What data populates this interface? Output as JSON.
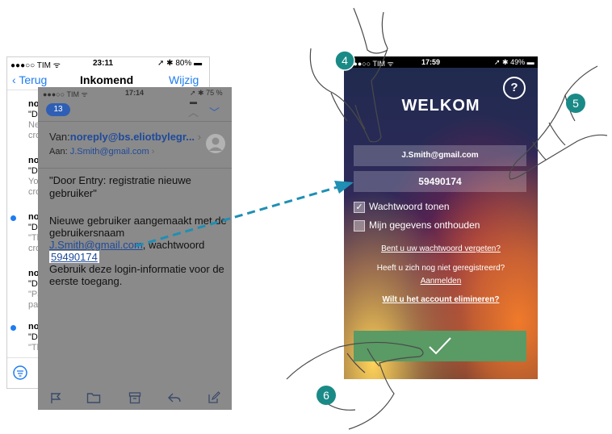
{
  "inbox": {
    "status": {
      "carrier": "●●●○○ TIM ᯤ",
      "time": "23:11",
      "battery": "➚ ✱ 80% ▬"
    },
    "nav": {
      "back": "Terug",
      "title": "Inkomend",
      "edit": "Wijzig"
    },
    "rows": [
      {
        "sender": "nor",
        "subject": "\"Do",
        "preview1": "New",
        "preview2": "cro",
        "unread": false
      },
      {
        "sender": "nor",
        "subject": "\"Do",
        "preview1": "You",
        "preview2": "cro",
        "unread": false
      },
      {
        "sender": "nor",
        "subject": "\"Do",
        "preview1": "\"Th",
        "preview2": "cro",
        "unread": true
      },
      {
        "sender": "nor",
        "subject": "\"Do",
        "preview1": "\"Pa",
        "preview2": "pas",
        "unread": false
      },
      {
        "sender": "nor",
        "subject": "\"Do",
        "preview1": "\"Th",
        "preview2": "",
        "unread": true
      }
    ]
  },
  "email": {
    "status": {
      "carrier": "●●●○○ TIM ᯤ",
      "time": "17:14",
      "battery": "➚ ✱ 75 % ▬"
    },
    "badge": "13",
    "from_label": "Van:",
    "from_address": "noreply@bs.eliotbylegr...",
    "to_label": "Aan:",
    "to_address": "J.Smith@gmail.com",
    "subject": "\"Door Entry: registratie nieuwe gebruiker\"",
    "body_line1": "Nieuwe gebruiker aangemaakt met de gebruikersnaam",
    "body_user": "J.Smith@gmail.com",
    "body_pw_label": ", wachtwoord",
    "body_password": "59490174",
    "body_line3": "Gebruik deze login-informatie voor de eerste toegang."
  },
  "login": {
    "status": {
      "carrier": "●●●○○ TIM ᯤ",
      "time": "17:59",
      "battery": "➚ ✱ 49% ▬"
    },
    "help": "?",
    "title": "WELKOM",
    "email_value": "J.Smith@gmail.com",
    "password_value": "59490174",
    "show_password_label": "Wachtwoord tonen",
    "show_password_checked": true,
    "remember_label": "Mijn gegevens onthouden",
    "remember_checked": false,
    "forgot_link": "Bent u uw wachtwoord vergeten?",
    "not_registered": "Heeft u zich nog niet geregistreerd?",
    "register_link": "Aanmelden",
    "delete_account_link": "Wilt u het account elimineren?",
    "submit_color": "#5a9a64"
  },
  "steps": {
    "four": "4",
    "five": "5",
    "six": "6"
  },
  "colors": {
    "accent_teal": "#1a8a87",
    "ios_blue": "#1e7cf2",
    "arrow": "#1f8fb4"
  }
}
